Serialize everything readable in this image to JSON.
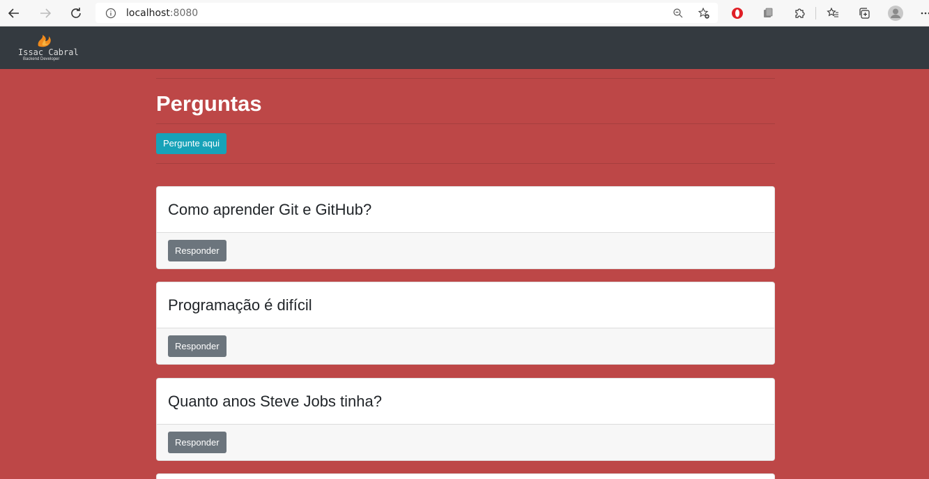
{
  "browser": {
    "url_host": "localhost",
    "url_port": ":8080",
    "icons": [
      "back-icon",
      "forward-icon",
      "reload-icon",
      "info-icon",
      "zoom-icon",
      "add-favorite-icon",
      "opera-icon",
      "extension-icon",
      "puzzle-icon",
      "favorites-icon",
      "collections-icon",
      "profile-icon",
      "more-icon"
    ]
  },
  "navbar": {
    "logo_name": "Issac Cabral",
    "logo_sub": "Backend Developer"
  },
  "page": {
    "title": "Perguntas",
    "ask_button": "Pergunte aqui"
  },
  "questions": [
    {
      "title": "Como aprender Git e GitHub?",
      "reply_label": "Responder"
    },
    {
      "title": "Programação é difícil",
      "reply_label": "Responder"
    },
    {
      "title": "Quanto anos Steve Jobs tinha?",
      "reply_label": "Responder"
    }
  ],
  "colors": {
    "background": "#bd4747",
    "navbar": "#343a40",
    "primary_button": "#17a2b8",
    "secondary_button": "#6c757d"
  }
}
